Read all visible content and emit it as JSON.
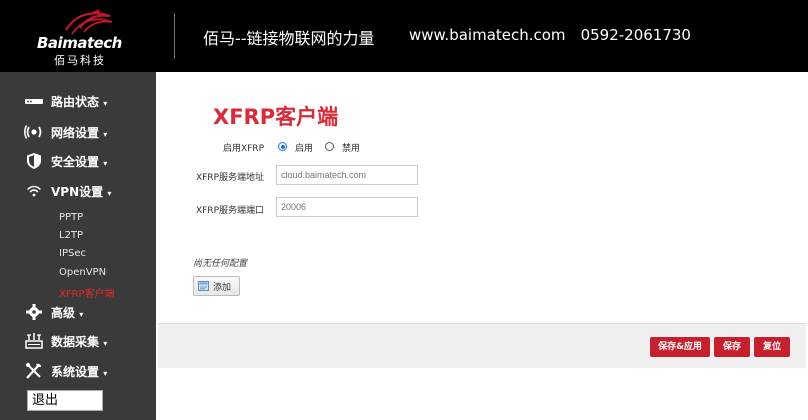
{
  "header": {
    "logo_brand": "Baimatech",
    "logo_cn": "佰马科技",
    "slogan": "佰马--链接物联网的力量",
    "website": "www.baimatech.com",
    "phone": "0592-2061730"
  },
  "sidebar": {
    "items": [
      {
        "label": "路由状态",
        "icon": "router-icon"
      },
      {
        "label": "网络设置",
        "icon": "network-icon"
      },
      {
        "label": "安全设置",
        "icon": "shield-icon"
      },
      {
        "label": "VPN设置",
        "icon": "wifi-icon"
      },
      {
        "label": "高级",
        "icon": "gear-icon"
      },
      {
        "label": "数据采集",
        "icon": "data-collect-icon"
      },
      {
        "label": "系统设置",
        "icon": "tools-icon"
      }
    ],
    "vpn_sub": [
      "PPTP",
      "L2TP",
      "IPSec",
      "OpenVPN",
      "XFRP客户端"
    ],
    "active_sub": "XFRP客户端",
    "logout": "退出"
  },
  "main": {
    "title": "XFRP客户端",
    "enable_label": "启用XFRP",
    "enable_on": "启用",
    "enable_off": "禁用",
    "enable_value": "启用",
    "server_addr_label": "XFRP服务端地址",
    "server_addr_value": "cloud.baimatech.com",
    "server_port_label": "XFRP服务端端口",
    "server_port_value": "20006",
    "empty_note": "尚无任何配置",
    "add_label": "添加"
  },
  "actions": {
    "save_apply": "保存&应用",
    "save": "保存",
    "reset": "复位"
  },
  "colors": {
    "accent_red": "#d82a38",
    "button_red": "#c6202e",
    "sidebar_bg": "#3a3a3a",
    "header_bg": "#000000"
  }
}
